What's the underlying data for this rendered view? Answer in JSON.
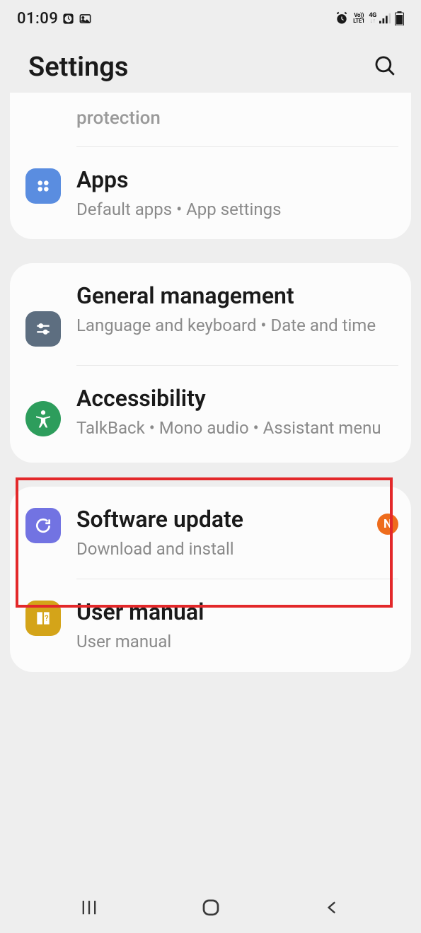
{
  "status": {
    "time": "01:09",
    "lte_top": "Vo))",
    "lte_bottom": "LTE1",
    "net": "4G"
  },
  "header": {
    "title": "Settings"
  },
  "partial_item": {
    "subtitle": "protection"
  },
  "apps": {
    "title": "Apps",
    "subtitle": "Default apps  •  App settings"
  },
  "general": {
    "title": "General management",
    "subtitle": "Language and keyboard  •  Date and time"
  },
  "accessibility": {
    "title": "Accessibility",
    "subtitle": "TalkBack  •  Mono audio  •  Assistant menu"
  },
  "software": {
    "title": "Software update",
    "subtitle": "Download and install",
    "badge": "N"
  },
  "manual": {
    "title": "User manual",
    "subtitle": "User manual"
  }
}
